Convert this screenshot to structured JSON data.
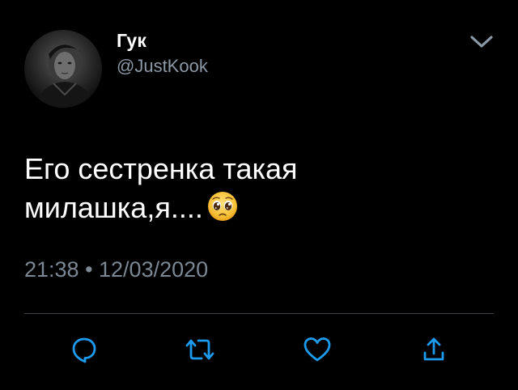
{
  "author": {
    "display_name": "Гук",
    "handle": "@JustKook",
    "avatar_icon": "profile-photo"
  },
  "tweet": {
    "line1": "Его сестренка такая",
    "line2": "милашка,я....",
    "emoji_icon": "pleading-face-emoji",
    "timestamp": "21:38 • 12/03/2020"
  },
  "actions": {
    "reply_icon": "reply-icon",
    "retweet_icon": "retweet-icon",
    "like_icon": "heart-icon",
    "share_icon": "share-icon"
  },
  "colors": {
    "background": "#000000",
    "text": "#ffffff",
    "secondary_text": "#8b98a5",
    "icon": "#1d9bf0",
    "divider": "#38444d"
  }
}
